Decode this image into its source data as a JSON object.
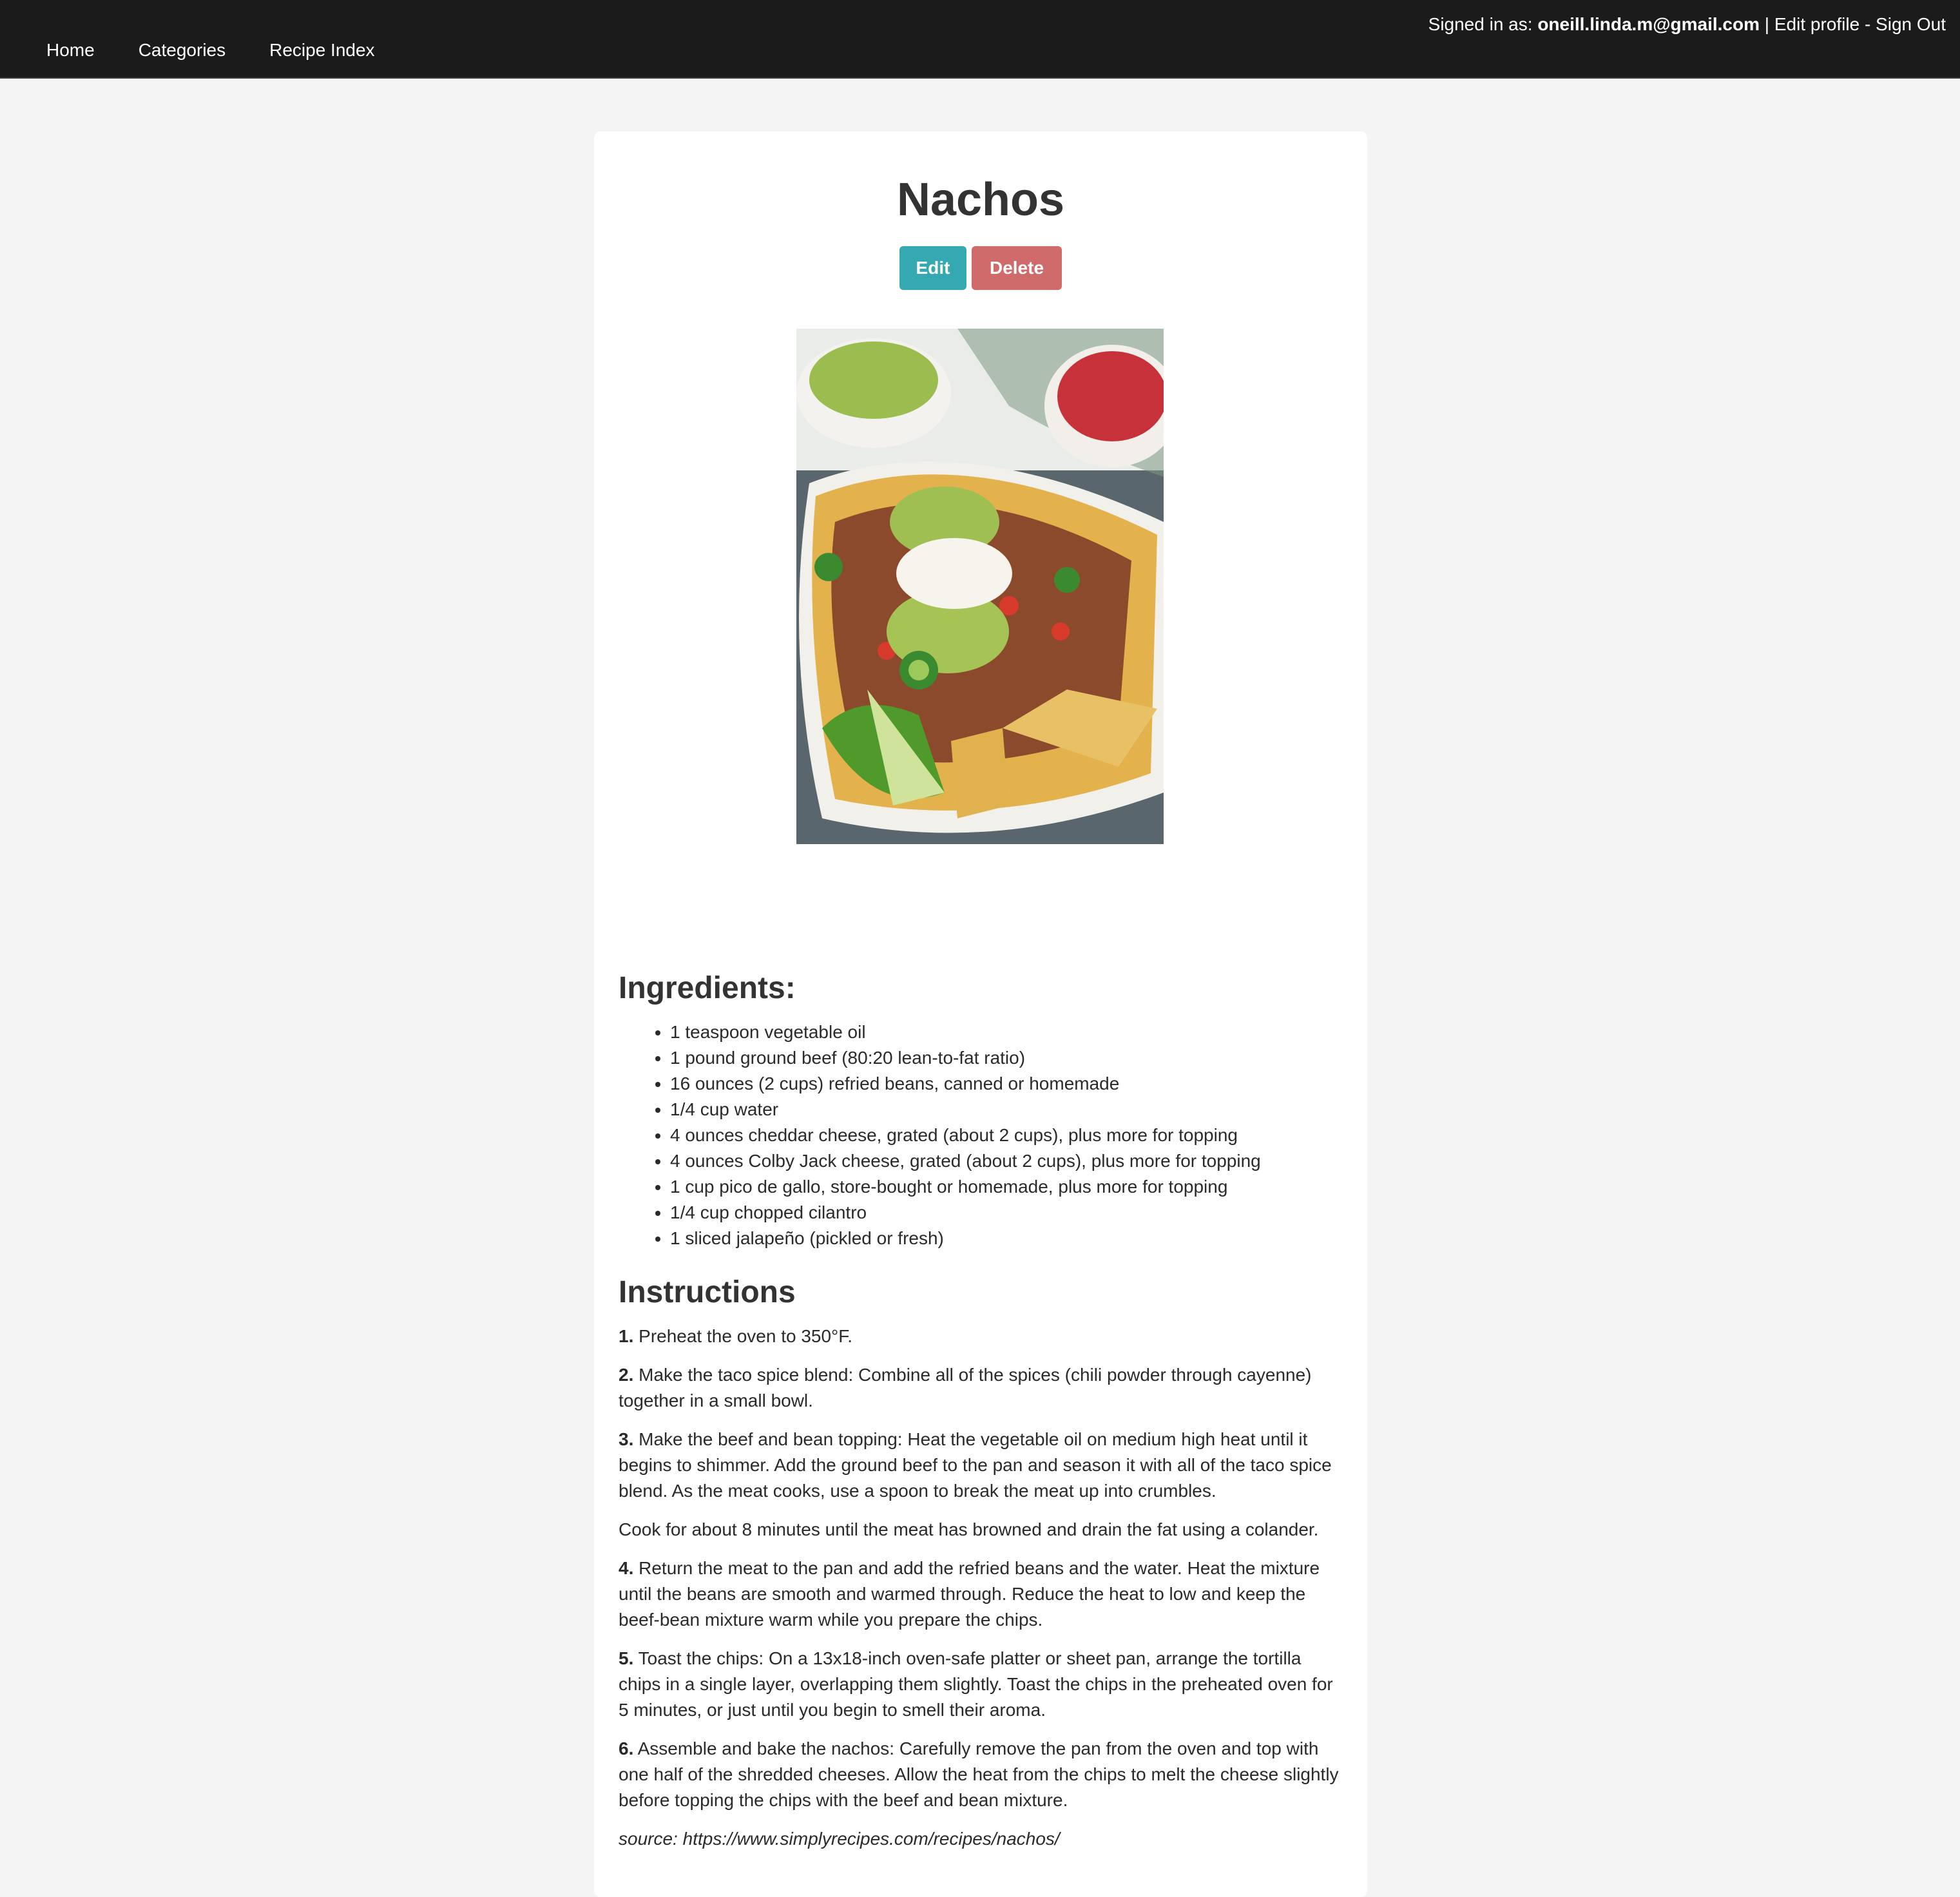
{
  "nav": {
    "items": [
      "Home",
      "Categories",
      "Recipe Index"
    ]
  },
  "user": {
    "prefix": "Signed in as:",
    "email": "oneill.linda.m@gmail.com",
    "separator": "|",
    "edit_profile": "Edit profile",
    "dash": "-",
    "sign_out": "Sign Out"
  },
  "recipe": {
    "title": "Nachos",
    "edit_label": "Edit",
    "delete_label": "Delete",
    "ingredients_heading": "Ingredients:",
    "ingredients": [
      "1 teaspoon vegetable oil",
      "1 pound ground beef (80:20 lean-to-fat ratio)",
      "16 ounces (2 cups) refried beans, canned or homemade",
      "1/4 cup water",
      "4 ounces cheddar cheese, grated (about 2 cups), plus more for topping",
      "4 ounces Colby Jack cheese, grated (about 2 cups), plus more for topping",
      "1 cup pico de gallo, store-bought or homemade, plus more for topping",
      "1/4 cup chopped cilantro",
      "1 sliced jalapeño (pickled or fresh)"
    ],
    "instructions_heading": "Instructions",
    "steps": [
      {
        "num": "1.",
        "text": "Preheat the oven to 350°F."
      },
      {
        "num": "2.",
        "text": "Make the taco spice blend: Combine all of the spices (chili powder through cayenne) together in a small bowl."
      },
      {
        "num": "3.",
        "text": "Make the beef and bean topping: Heat the vegetable oil on medium high heat until it begins to shimmer. Add the ground beef to the pan and season it with all of the taco spice blend. As the meat cooks, use a spoon to break the meat up into crumbles."
      },
      {
        "num": "",
        "text": "Cook for about 8 minutes until the meat has browned and drain the fat using a colander."
      },
      {
        "num": "4.",
        "text": "Return the meat to the pan and add the refried beans and the water. Heat the mixture until the beans are smooth and warmed through. Reduce the heat to low and keep the beef-bean mixture warm while you prepare the chips."
      },
      {
        "num": "5.",
        "text": "Toast the chips: On a 13x18-inch oven-safe platter or sheet pan, arrange the tortilla chips in a single layer, overlapping them slightly. Toast the chips in the preheated oven for 5 minutes, or just until you begin to smell their aroma."
      },
      {
        "num": "6.",
        "text": "Assemble and bake the nachos: Carefully remove the pan from the oven and top with one half of the shredded cheeses. Allow the heat from the chips to melt the cheese slightly before topping the chips with the beef and bean mixture."
      }
    ],
    "source_label": "source:",
    "source_url": "https://www.simplyrecipes.com/recipes/nachos/"
  },
  "colors": {
    "topbar": "#1b1b1b",
    "edit_button": "#34a9b1",
    "delete_button": "#cf6b6b",
    "page_background": "#f4f4f4"
  }
}
